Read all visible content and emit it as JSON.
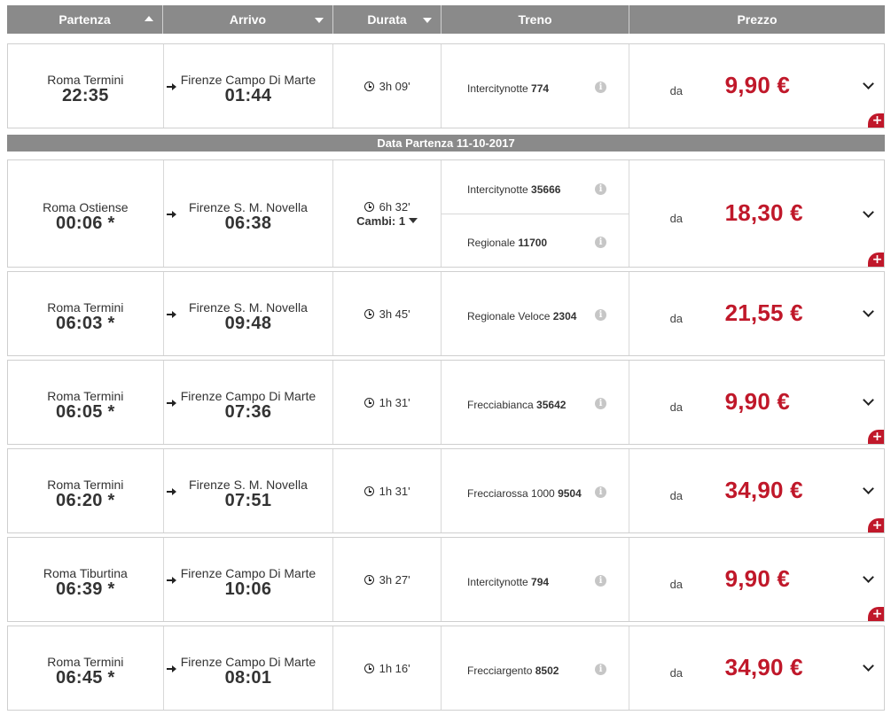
{
  "header": {
    "departure": "Partenza",
    "arrival": "Arrivo",
    "duration": "Durata",
    "train": "Treno",
    "price": "Prezzo"
  },
  "date_separator": "Data Partenza 11-10-2017",
  "price_prefix": "da",
  "changes_label": "Cambi: 1",
  "accent_color": "#c0182a",
  "solutions": [
    {
      "dep_station": "Roma Termini",
      "dep_time": "22:35",
      "arr_station": "Firenze Campo Di Marte",
      "arr_time": "01:44",
      "duration": "3h 09'",
      "trains": [
        {
          "type": "Intercitynotte",
          "number": "774"
        }
      ],
      "price": "9,90 €"
    },
    {
      "dep_station": "Roma Ostiense",
      "dep_time": "00:06 *",
      "arr_station": "Firenze S. M. Novella",
      "arr_time": "06:38",
      "duration": "6h 32'",
      "changes": "Cambi: 1",
      "trains": [
        {
          "type": "Intercitynotte",
          "number": "35666"
        },
        {
          "type": "Regionale",
          "number": "11700"
        }
      ],
      "price": "18,30 €"
    },
    {
      "dep_station": "Roma Termini",
      "dep_time": "06:03 *",
      "arr_station": "Firenze S. M. Novella",
      "arr_time": "09:48",
      "duration": "3h 45'",
      "trains": [
        {
          "type": "Regionale Veloce",
          "number": "2304"
        }
      ],
      "price": "21,55 €"
    },
    {
      "dep_station": "Roma Termini",
      "dep_time": "06:05 *",
      "arr_station": "Firenze Campo Di Marte",
      "arr_time": "07:36",
      "duration": "1h 31'",
      "trains": [
        {
          "type": "Frecciabianca",
          "number": "35642"
        }
      ],
      "price": "9,90 €"
    },
    {
      "dep_station": "Roma Termini",
      "dep_time": "06:20 *",
      "arr_station": "Firenze S. M. Novella",
      "arr_time": "07:51",
      "duration": "1h 31'",
      "trains": [
        {
          "type": "Frecciarossa 1000",
          "number": "9504"
        }
      ],
      "price": "34,90 €"
    },
    {
      "dep_station": "Roma Tiburtina",
      "dep_time": "06:39 *",
      "arr_station": "Firenze Campo Di Marte",
      "arr_time": "10:06",
      "duration": "3h 27'",
      "trains": [
        {
          "type": "Intercitynotte",
          "number": "794"
        }
      ],
      "price": "9,90 €"
    },
    {
      "dep_station": "Roma Termini",
      "dep_time": "06:45 *",
      "arr_station": "Firenze Campo Di Marte",
      "arr_time": "08:01",
      "duration": "1h 16'",
      "trains": [
        {
          "type": "Frecciargento",
          "number": "8502"
        }
      ],
      "price": "34,90 €"
    }
  ]
}
